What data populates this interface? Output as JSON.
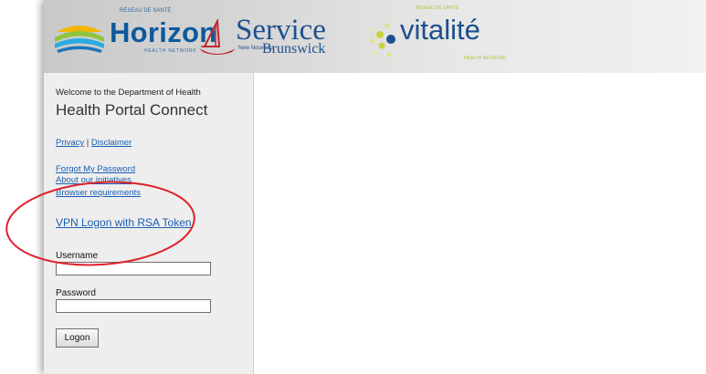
{
  "banner": {
    "horizon": {
      "name": "Horizon",
      "top_text": "RÉSEAU DE SANTÉ",
      "sub_text": "HEALTH NETWORK"
    },
    "service_nb": {
      "word1": "Service",
      "small": "New Nouveau",
      "word2": "Brunswick"
    },
    "vitalite": {
      "name": "vitalité",
      "top_text": "RÉSEAU DE SANTÉ",
      "sub_text": "HEALTH NETWORK"
    }
  },
  "sidebar": {
    "welcome": "Welcome to the Department of Health",
    "title": "Health Portal Connect",
    "privacy_link": "Privacy",
    "separator": "|",
    "disclaimer_link": "Disclaimer",
    "forgot_link": "Forgot My Password",
    "about_link": "About our initiatives",
    "browser_link": "Browser requirements",
    "vpn_link": "VPN Logon with RSA Token",
    "username_label": "Username",
    "username_value": "",
    "password_label": "Password",
    "password_value": "",
    "logon_label": "Logon"
  },
  "colors": {
    "link": "#1a5fb4",
    "annotation": "#e0202a",
    "sidebar_bg": "#eeeeee"
  }
}
